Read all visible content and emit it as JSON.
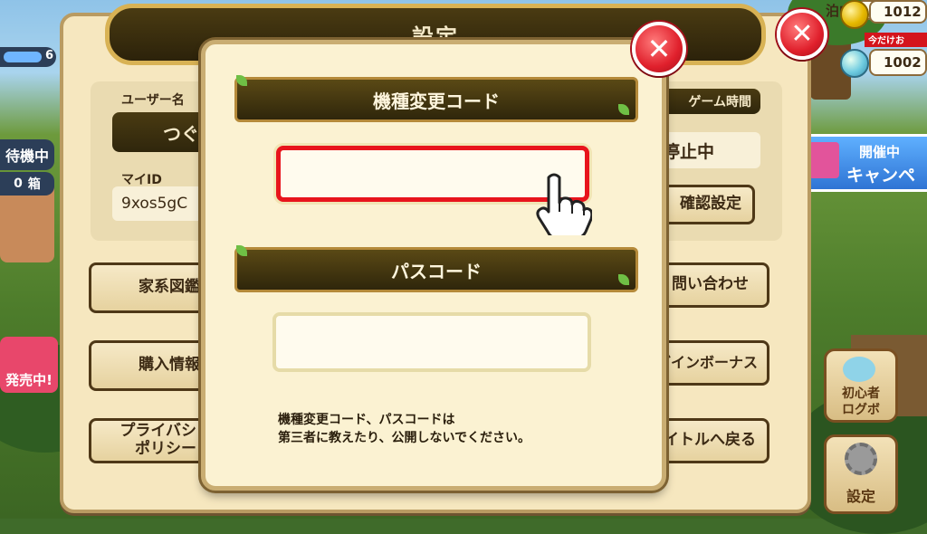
{
  "hud": {
    "top_partial": "泊中",
    "coins": "1012",
    "gems": "1002",
    "promo_tag": "今だけお",
    "left_stat": "6",
    "waiting_label": "待機中",
    "waiting_count": "0",
    "waiting_unit": "箱",
    "campaign_line1": "開催中",
    "campaign_line2": "キャンペ",
    "sale_label": "発売中!",
    "beginner_line1": "初心者",
    "beginner_line2": "ログボ",
    "settings_label": "設定"
  },
  "settings": {
    "title": "設定",
    "user_name_label": "ユーザー名",
    "user_name_value": "つぐ",
    "my_id_label": "マイID",
    "my_id_value": "9xos5gC",
    "game_time_label": "ゲーム時間",
    "game_time_value": "停止中",
    "confirm_settings_label": "確認設定",
    "family_tree_label": "家系図鑑",
    "purchase_info_label": "購入情報",
    "privacy_line1": "プライバシ",
    "privacy_line2": "ポリシー",
    "contact_label": "問い合わせ",
    "login_bonus_label": "グインボーナス",
    "back_to_title_label": "イトルへ戻る"
  },
  "dialog": {
    "device_code_header": "機種変更コード",
    "device_code_value": "",
    "passcode_header": "パスコード",
    "passcode_value": "",
    "note_line1": "機種変更コード、パスコードは",
    "note_line2": "第三者に教えたり、公開しないでください。"
  },
  "icons": {
    "close": "close-icon",
    "pointer": "pointing-hand-icon",
    "gear": "gear-icon"
  },
  "colors": {
    "highlight": "#e8141c",
    "close_red": "#e0202c"
  }
}
